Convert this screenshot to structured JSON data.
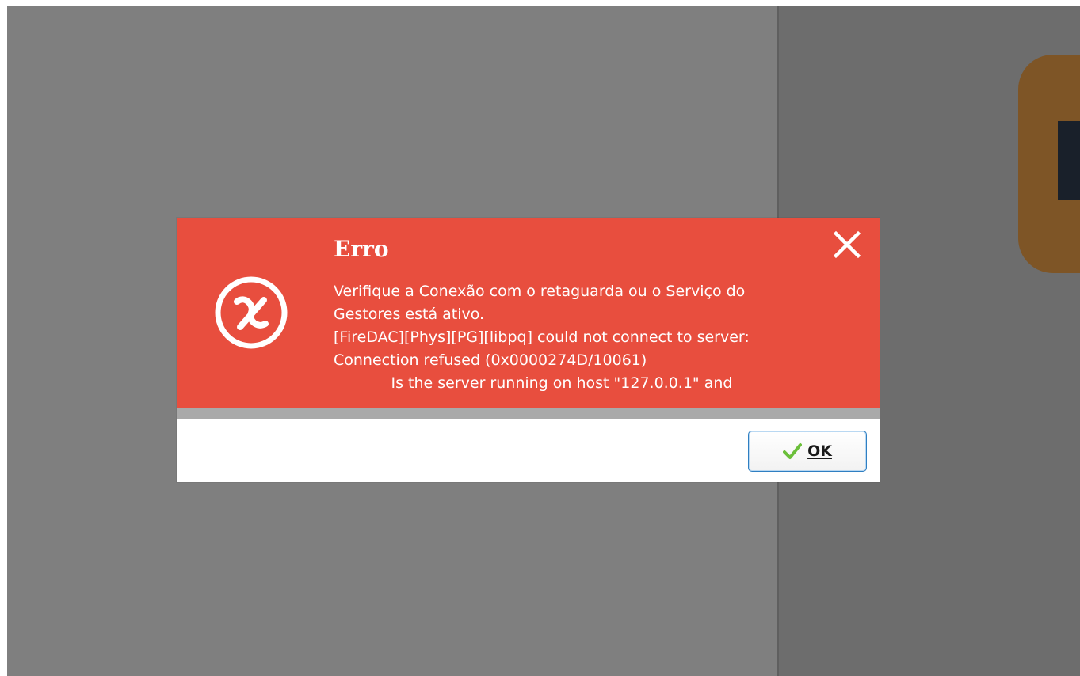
{
  "dialog": {
    "title": "Erro",
    "message_lines": [
      "Verifique a Conexão com o retaguarda ou o Serviço do",
      "Gestores está ativo.",
      "[FireDAC][Phys][PG][libpq] could not connect to server:",
      "Connection refused (0x0000274D/10061)",
      "            Is the server running on host \"127.0.0.1\" and"
    ],
    "ok_label": "OK",
    "icons": {
      "error": "error-circle-icon",
      "close": "close-icon",
      "ok": "checkmark-icon"
    }
  },
  "colors": {
    "header": "#e84e3e",
    "backdrop": "#7f7f7f",
    "right_panel": "#6d6d6d",
    "app_tile": "#7e5526",
    "ok_border": "#2f7fc2",
    "check": "#6bbf3a"
  }
}
